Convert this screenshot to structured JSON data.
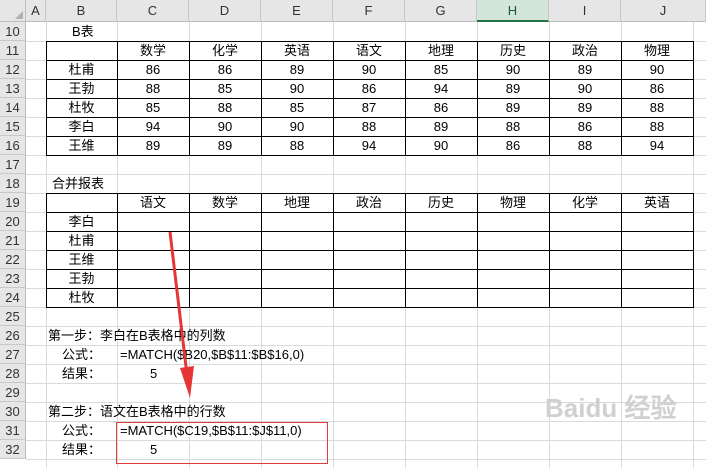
{
  "columns": [
    "A",
    "B",
    "C",
    "D",
    "E",
    "F",
    "G",
    "H",
    "I",
    "J"
  ],
  "selected_column": "H",
  "row_numbers": [
    "10",
    "11",
    "12",
    "13",
    "14",
    "15",
    "16",
    "17",
    "18",
    "19",
    "20",
    "21",
    "22",
    "23",
    "24",
    "25",
    "26",
    "27",
    "28",
    "29",
    "30",
    "31",
    "32"
  ],
  "table_b": {
    "title": "B表",
    "headers": [
      "数学",
      "化学",
      "英语",
      "语文",
      "地理",
      "历史",
      "政治",
      "物理"
    ],
    "rows": [
      {
        "name": "杜甫",
        "values": [
          "86",
          "86",
          "89",
          "90",
          "85",
          "90",
          "89",
          "90"
        ]
      },
      {
        "name": "王勃",
        "values": [
          "88",
          "85",
          "90",
          "86",
          "94",
          "89",
          "90",
          "86"
        ]
      },
      {
        "name": "杜牧",
        "values": [
          "85",
          "88",
          "85",
          "87",
          "86",
          "89",
          "89",
          "88"
        ]
      },
      {
        "name": "李白",
        "values": [
          "94",
          "90",
          "90",
          "88",
          "89",
          "88",
          "86",
          "88"
        ]
      },
      {
        "name": "王维",
        "values": [
          "89",
          "89",
          "88",
          "94",
          "90",
          "86",
          "88",
          "94"
        ]
      }
    ]
  },
  "merged": {
    "title": "合并报表",
    "headers": [
      "语文",
      "数学",
      "地理",
      "政治",
      "历史",
      "物理",
      "化学",
      "英语"
    ],
    "names": [
      "李白",
      "杜甫",
      "王维",
      "王勃",
      "杜牧"
    ]
  },
  "step1": {
    "title": "第一步：李白在B表格中的列数",
    "formula_label": "公式：",
    "formula": "=MATCH($B20,$B$11:$B$16,0)",
    "result_label": "结果：",
    "result": "5"
  },
  "step2": {
    "title": "第二步：语文在B表格中的行数",
    "formula_label": "公式：",
    "formula": "=MATCH($C19,$B$11:$J$11,0)",
    "result_label": "结果：",
    "result": "5"
  },
  "watermark": "Baidu 经验",
  "colors": {
    "highlight": "#e03c3c",
    "selected_col": "#217346"
  }
}
